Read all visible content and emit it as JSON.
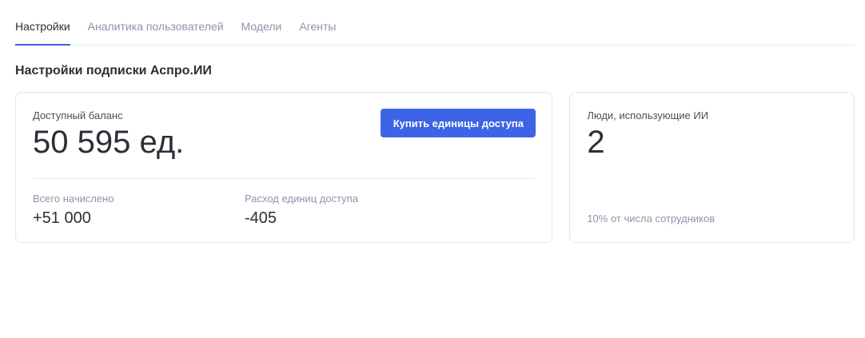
{
  "tabs": [
    {
      "label": "Настройки",
      "active": true
    },
    {
      "label": "Аналитика пользователей",
      "active": false
    },
    {
      "label": "Модели",
      "active": false
    },
    {
      "label": "Агенты",
      "active": false
    }
  ],
  "section_title": "Настройки подписки Аспро.ИИ",
  "balance_card": {
    "label": "Доступный баланс",
    "value": "50 595 ед.",
    "buy_button_label": "Купить единицы доступа",
    "total_label": "Всего начислено",
    "total_value": "+51 000",
    "spent_label": "Расход единиц доступа",
    "spent_value": "-405"
  },
  "people_card": {
    "label": "Люди, использующие ИИ",
    "value": "2",
    "footnote": "10% от числа сотрудников"
  },
  "colors": {
    "accent": "#3d63e6",
    "muted_text": "#8c95a8",
    "border": "#e3e6eb"
  }
}
